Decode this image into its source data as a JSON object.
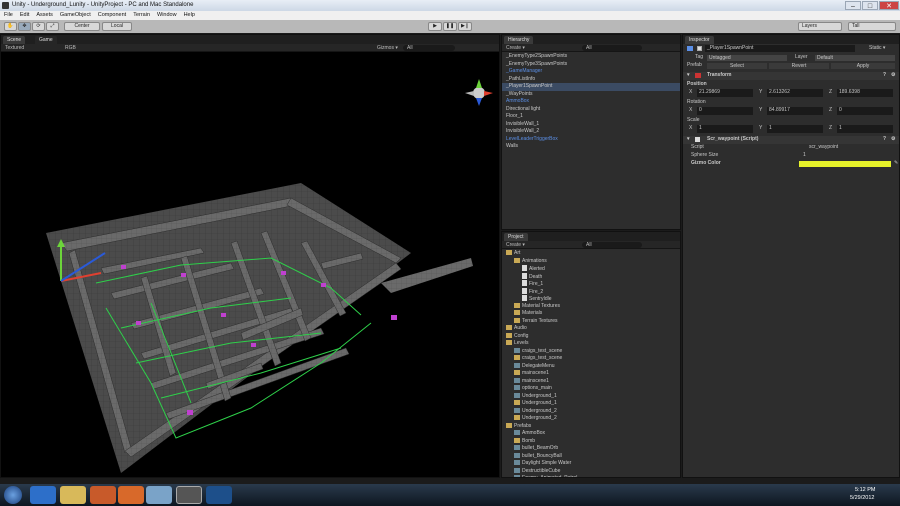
{
  "window": {
    "title": "Unity - Underground_Lunity - UnityProject - PC and Mac Standalone",
    "min": "–",
    "max": "□",
    "close": "✕"
  },
  "menu": [
    "File",
    "Edit",
    "Assets",
    "GameObject",
    "Component",
    "Terrain",
    "Window",
    "Help"
  ],
  "toolbar": {
    "center": "Center",
    "local": "Local",
    "play": "▶",
    "pause": "❚❚",
    "step": "▶❙",
    "layers": "Layers",
    "layout": "Tall"
  },
  "scene": {
    "tab_scene": "Scene",
    "tab_game": "Game",
    "mode": "Textured",
    "color": "RGB",
    "gizmos": "Gizmos ▾",
    "search": "All"
  },
  "hierarchy": {
    "tab": "Hierarchy",
    "create": "Create ▾",
    "search": "All",
    "items": [
      {
        "label": "_EnemyType2SpawnPoints",
        "blue": false,
        "sel": false
      },
      {
        "label": "_EnemyType3SpawnPoints",
        "blue": false,
        "sel": false
      },
      {
        "label": "_GameManager",
        "blue": true,
        "sel": false
      },
      {
        "label": "_PathListInfo",
        "blue": false,
        "sel": false
      },
      {
        "label": "_Player1SpawnPoint",
        "blue": false,
        "sel": true
      },
      {
        "label": "_WayPoints",
        "blue": false,
        "sel": false
      },
      {
        "label": "AmmoBox",
        "blue": true,
        "sel": false
      },
      {
        "label": "Directional light",
        "blue": false,
        "sel": false
      },
      {
        "label": "Floor_1",
        "blue": false,
        "sel": false
      },
      {
        "label": "InvisibleWall_1",
        "blue": false,
        "sel": false
      },
      {
        "label": "InvisibleWall_2",
        "blue": false,
        "sel": false
      },
      {
        "label": "LevelLeaderTriggerBox",
        "blue": true,
        "sel": false
      },
      {
        "label": "Walls",
        "blue": false,
        "sel": false
      }
    ]
  },
  "project": {
    "tab": "Project",
    "create": "Create ▾",
    "search": "All",
    "items": [
      {
        "label": "Art",
        "indent": 0,
        "kind": "folder"
      },
      {
        "label": "Animations",
        "indent": 1,
        "kind": "folder"
      },
      {
        "label": "Alerted",
        "indent": 2,
        "kind": "file"
      },
      {
        "label": "Death",
        "indent": 2,
        "kind": "file"
      },
      {
        "label": "Fire_1",
        "indent": 2,
        "kind": "file"
      },
      {
        "label": "Fire_2",
        "indent": 2,
        "kind": "file"
      },
      {
        "label": "SentryIdle",
        "indent": 2,
        "kind": "file"
      },
      {
        "label": "Material Textures",
        "indent": 1,
        "kind": "folder"
      },
      {
        "label": "Materials",
        "indent": 1,
        "kind": "folder"
      },
      {
        "label": "Terrain Textures",
        "indent": 1,
        "kind": "folder"
      },
      {
        "label": "Audio",
        "indent": 0,
        "kind": "folder"
      },
      {
        "label": "Config",
        "indent": 0,
        "kind": "folder"
      },
      {
        "label": "Levels",
        "indent": 0,
        "kind": "folder"
      },
      {
        "label": "craigs_test_scene",
        "indent": 1,
        "kind": "scene"
      },
      {
        "label": "craigs_test_scene",
        "indent": 1,
        "kind": "folder"
      },
      {
        "label": "DelegateMenu",
        "indent": 1,
        "kind": "scene"
      },
      {
        "label": "mainscene1",
        "indent": 1,
        "kind": "folder"
      },
      {
        "label": "mainscene1",
        "indent": 1,
        "kind": "scene"
      },
      {
        "label": "options_main",
        "indent": 1,
        "kind": "scene"
      },
      {
        "label": "Underground_1",
        "indent": 1,
        "kind": "scene"
      },
      {
        "label": "Underground_1",
        "indent": 1,
        "kind": "folder"
      },
      {
        "label": "Underground_2",
        "indent": 1,
        "kind": "scene"
      },
      {
        "label": "Underground_2",
        "indent": 1,
        "kind": "folder"
      },
      {
        "label": "Prefabs",
        "indent": 0,
        "kind": "folder"
      },
      {
        "label": "AmmoBox",
        "indent": 1,
        "kind": "prefab"
      },
      {
        "label": "Bomb",
        "indent": 1,
        "kind": "folder"
      },
      {
        "label": "bullet_BeamOrb",
        "indent": 1,
        "kind": "prefab"
      },
      {
        "label": "bullet_BouncyBall",
        "indent": 1,
        "kind": "prefab"
      },
      {
        "label": "Daylight Simple Water",
        "indent": 1,
        "kind": "prefab"
      },
      {
        "label": "DestructibleCube",
        "indent": 1,
        "kind": "prefab"
      },
      {
        "label": "Enemy_Animated_Patrol",
        "indent": 1,
        "kind": "prefab"
      }
    ]
  },
  "inspector": {
    "tab": "Inspector",
    "name": "_Player1SpawnPoint",
    "static": "Static ▾",
    "tag_label": "Tag",
    "tag": "Untagged",
    "layer_label": "Layer",
    "layer": "Default",
    "prefab_label": "Prefab",
    "select": "Select",
    "revert": "Revert",
    "apply": "Apply",
    "transform": "Transform",
    "position": "Position",
    "pos": {
      "x": "21.29869",
      "y": "2.613262",
      "z": "189.6398"
    },
    "rotation": "Rotation",
    "rot": {
      "x": "0",
      "y": "84.89917",
      "z": "0"
    },
    "scale": "Scale",
    "scl": {
      "x": "1",
      "y": "1",
      "z": "1"
    },
    "script_title": "Scr_waypoint (Script)",
    "script_label": "Script",
    "script_value": "scr_waypoint",
    "sphere_label": "Sphere Size",
    "sphere_value": "1",
    "gizmo_label": "Gizmo Color",
    "gizmo_color": "#e6f22a",
    "axis": {
      "x": "X",
      "y": "Y",
      "z": "Z"
    }
  },
  "taskbar": {
    "time": "5:12 PM",
    "date": "5/29/2012"
  }
}
